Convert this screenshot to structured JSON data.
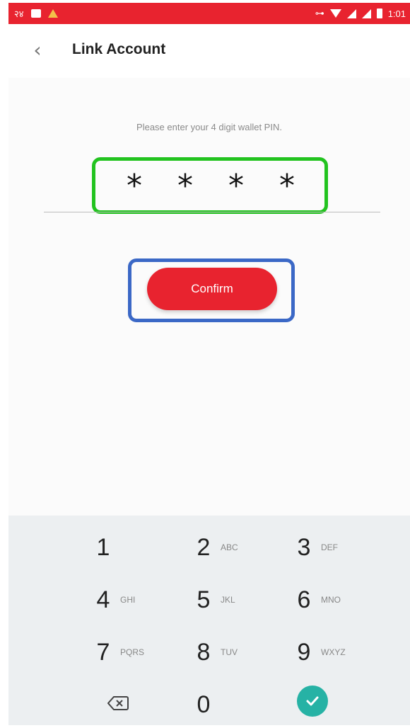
{
  "status_bar": {
    "left_text": "२४",
    "time": "1:01"
  },
  "header": {
    "title": "Link Account"
  },
  "main": {
    "instruction": "Please enter your 4 digit wallet PIN.",
    "pin_value": "* * * *",
    "confirm_label": "Confirm"
  },
  "keypad": {
    "keys": [
      {
        "digit": "1",
        "letters": ""
      },
      {
        "digit": "2",
        "letters": "ABC"
      },
      {
        "digit": "3",
        "letters": "DEF"
      },
      {
        "digit": "4",
        "letters": "GHI"
      },
      {
        "digit": "5",
        "letters": "JKL"
      },
      {
        "digit": "6",
        "letters": "MNO"
      },
      {
        "digit": "7",
        "letters": "PQRS"
      },
      {
        "digit": "8",
        "letters": "TUV"
      },
      {
        "digit": "9",
        "letters": "WXYZ"
      },
      {
        "digit": "0",
        "letters": ""
      }
    ]
  },
  "colors": {
    "accent": "#e8232f",
    "pin_highlight": "#22c31f",
    "button_highlight": "#3b68c6",
    "done_key": "#26b2a5"
  },
  "icons": [
    "back-arrow-icon",
    "backspace-icon",
    "check-icon",
    "wifi-icon",
    "signal-icon",
    "battery-icon",
    "key-icon"
  ]
}
